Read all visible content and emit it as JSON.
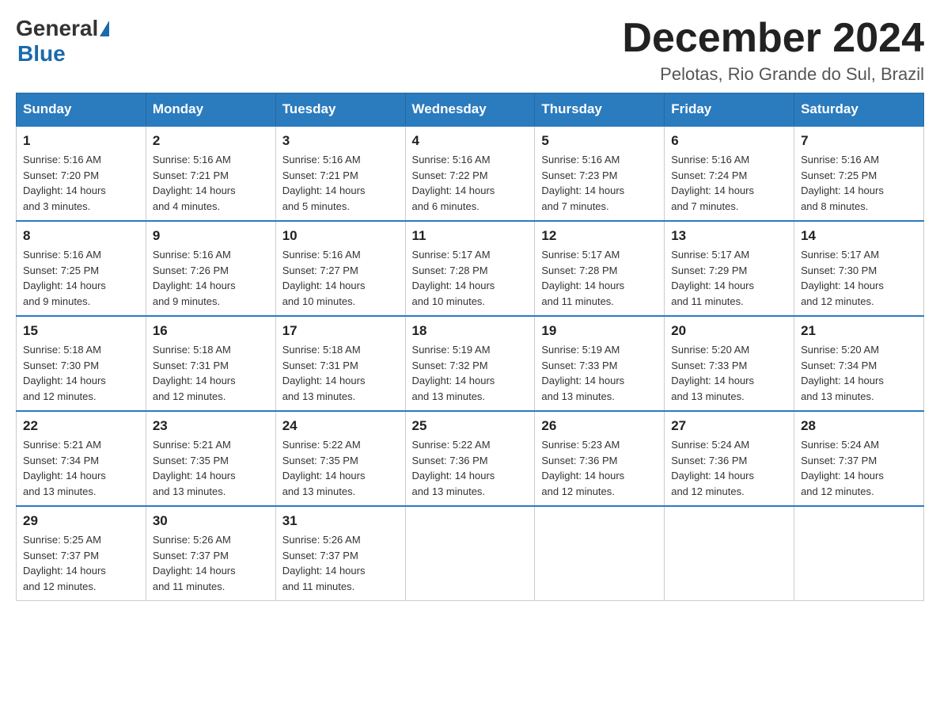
{
  "logo": {
    "general": "General",
    "blue": "Blue"
  },
  "title": "December 2024",
  "location": "Pelotas, Rio Grande do Sul, Brazil",
  "days_of_week": [
    "Sunday",
    "Monday",
    "Tuesday",
    "Wednesday",
    "Thursday",
    "Friday",
    "Saturday"
  ],
  "weeks": [
    [
      {
        "day": "1",
        "sunrise": "5:16 AM",
        "sunset": "7:20 PM",
        "daylight": "14 hours and 3 minutes."
      },
      {
        "day": "2",
        "sunrise": "5:16 AM",
        "sunset": "7:21 PM",
        "daylight": "14 hours and 4 minutes."
      },
      {
        "day": "3",
        "sunrise": "5:16 AM",
        "sunset": "7:21 PM",
        "daylight": "14 hours and 5 minutes."
      },
      {
        "day": "4",
        "sunrise": "5:16 AM",
        "sunset": "7:22 PM",
        "daylight": "14 hours and 6 minutes."
      },
      {
        "day": "5",
        "sunrise": "5:16 AM",
        "sunset": "7:23 PM",
        "daylight": "14 hours and 7 minutes."
      },
      {
        "day": "6",
        "sunrise": "5:16 AM",
        "sunset": "7:24 PM",
        "daylight": "14 hours and 7 minutes."
      },
      {
        "day": "7",
        "sunrise": "5:16 AM",
        "sunset": "7:25 PM",
        "daylight": "14 hours and 8 minutes."
      }
    ],
    [
      {
        "day": "8",
        "sunrise": "5:16 AM",
        "sunset": "7:25 PM",
        "daylight": "14 hours and 9 minutes."
      },
      {
        "day": "9",
        "sunrise": "5:16 AM",
        "sunset": "7:26 PM",
        "daylight": "14 hours and 9 minutes."
      },
      {
        "day": "10",
        "sunrise": "5:16 AM",
        "sunset": "7:27 PM",
        "daylight": "14 hours and 10 minutes."
      },
      {
        "day": "11",
        "sunrise": "5:17 AM",
        "sunset": "7:28 PM",
        "daylight": "14 hours and 10 minutes."
      },
      {
        "day": "12",
        "sunrise": "5:17 AM",
        "sunset": "7:28 PM",
        "daylight": "14 hours and 11 minutes."
      },
      {
        "day": "13",
        "sunrise": "5:17 AM",
        "sunset": "7:29 PM",
        "daylight": "14 hours and 11 minutes."
      },
      {
        "day": "14",
        "sunrise": "5:17 AM",
        "sunset": "7:30 PM",
        "daylight": "14 hours and 12 minutes."
      }
    ],
    [
      {
        "day": "15",
        "sunrise": "5:18 AM",
        "sunset": "7:30 PM",
        "daylight": "14 hours and 12 minutes."
      },
      {
        "day": "16",
        "sunrise": "5:18 AM",
        "sunset": "7:31 PM",
        "daylight": "14 hours and 12 minutes."
      },
      {
        "day": "17",
        "sunrise": "5:18 AM",
        "sunset": "7:31 PM",
        "daylight": "14 hours and 13 minutes."
      },
      {
        "day": "18",
        "sunrise": "5:19 AM",
        "sunset": "7:32 PM",
        "daylight": "14 hours and 13 minutes."
      },
      {
        "day": "19",
        "sunrise": "5:19 AM",
        "sunset": "7:33 PM",
        "daylight": "14 hours and 13 minutes."
      },
      {
        "day": "20",
        "sunrise": "5:20 AM",
        "sunset": "7:33 PM",
        "daylight": "14 hours and 13 minutes."
      },
      {
        "day": "21",
        "sunrise": "5:20 AM",
        "sunset": "7:34 PM",
        "daylight": "14 hours and 13 minutes."
      }
    ],
    [
      {
        "day": "22",
        "sunrise": "5:21 AM",
        "sunset": "7:34 PM",
        "daylight": "14 hours and 13 minutes."
      },
      {
        "day": "23",
        "sunrise": "5:21 AM",
        "sunset": "7:35 PM",
        "daylight": "14 hours and 13 minutes."
      },
      {
        "day": "24",
        "sunrise": "5:22 AM",
        "sunset": "7:35 PM",
        "daylight": "14 hours and 13 minutes."
      },
      {
        "day": "25",
        "sunrise": "5:22 AM",
        "sunset": "7:36 PM",
        "daylight": "14 hours and 13 minutes."
      },
      {
        "day": "26",
        "sunrise": "5:23 AM",
        "sunset": "7:36 PM",
        "daylight": "14 hours and 12 minutes."
      },
      {
        "day": "27",
        "sunrise": "5:24 AM",
        "sunset": "7:36 PM",
        "daylight": "14 hours and 12 minutes."
      },
      {
        "day": "28",
        "sunrise": "5:24 AM",
        "sunset": "7:37 PM",
        "daylight": "14 hours and 12 minutes."
      }
    ],
    [
      {
        "day": "29",
        "sunrise": "5:25 AM",
        "sunset": "7:37 PM",
        "daylight": "14 hours and 12 minutes."
      },
      {
        "day": "30",
        "sunrise": "5:26 AM",
        "sunset": "7:37 PM",
        "daylight": "14 hours and 11 minutes."
      },
      {
        "day": "31",
        "sunrise": "5:26 AM",
        "sunset": "7:37 PM",
        "daylight": "14 hours and 11 minutes."
      },
      null,
      null,
      null,
      null
    ]
  ],
  "labels": {
    "sunrise_prefix": "Sunrise: ",
    "sunset_prefix": "Sunset: ",
    "daylight_prefix": "Daylight: "
  }
}
